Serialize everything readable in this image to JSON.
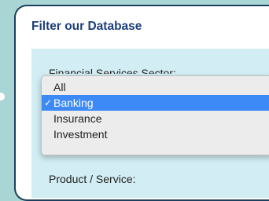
{
  "panel": {
    "title": "Filter our Database",
    "fields": {
      "sector_label": "Financial Services Sector:",
      "product_label": "Product / Service:"
    }
  },
  "dropdown": {
    "options": [
      {
        "label": "All"
      },
      {
        "label": "Banking"
      },
      {
        "label": "Insurance"
      },
      {
        "label": "Investment"
      }
    ],
    "selected_index": 1,
    "check_glyph": "✓"
  },
  "colors": {
    "background": "#a9d6d5",
    "panel_border": "#1f3f5e",
    "title": "#1b3f7a",
    "form_area": "#d2eef4",
    "selected": "#3d8af7"
  }
}
